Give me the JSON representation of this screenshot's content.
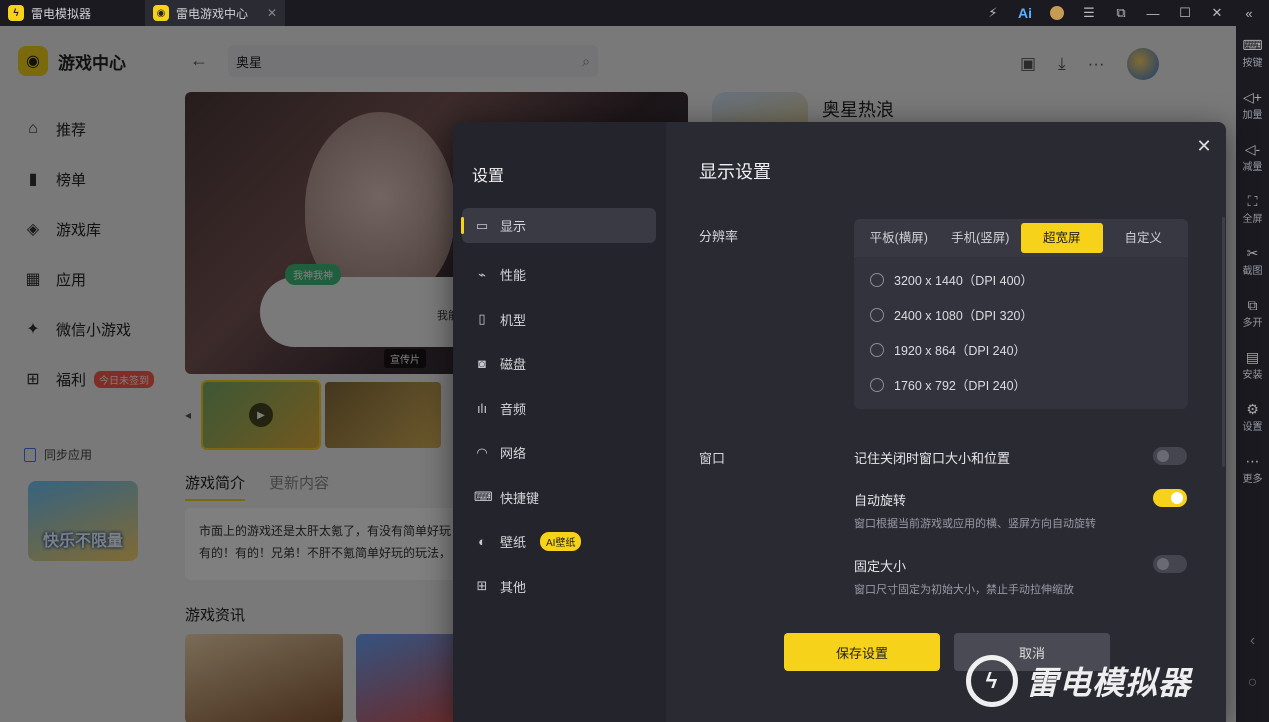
{
  "titlebar": {
    "tabs": [
      {
        "label": "雷电模拟器"
      },
      {
        "label": "雷电游戏中心"
      }
    ]
  },
  "right_toolbar": {
    "items": [
      {
        "label": "按键",
        "icon": "keyboard-icon"
      },
      {
        "label": "加量",
        "icon": "volume-up-icon"
      },
      {
        "label": "减量",
        "icon": "volume-down-icon"
      },
      {
        "label": "全屏",
        "icon": "fullscreen-icon"
      },
      {
        "label": "截图",
        "icon": "scissors-icon"
      },
      {
        "label": "多开",
        "icon": "multi-window-icon"
      },
      {
        "label": "安装",
        "icon": "install-icon"
      },
      {
        "label": "设置",
        "icon": "gear-icon"
      },
      {
        "label": "更多",
        "icon": "more-icon"
      }
    ]
  },
  "sidebar": {
    "brand": "游戏中心",
    "items": [
      {
        "label": "推荐",
        "icon": "home-icon"
      },
      {
        "label": "榜单",
        "icon": "chart-icon"
      },
      {
        "label": "游戏库",
        "icon": "gamepad-icon"
      },
      {
        "label": "应用",
        "icon": "apps-icon"
      },
      {
        "label": "微信小游戏",
        "icon": "mini-game-icon"
      },
      {
        "label": "福利",
        "icon": "gift-icon",
        "badge": "今日未签到"
      }
    ],
    "sync_label": "同步应用",
    "promo_text": "快乐不限量"
  },
  "header": {
    "search_value": "奥星"
  },
  "hero": {
    "tag": "我神我神",
    "bubble_text": "我能说",
    "video_tag": "宣传片"
  },
  "game": {
    "name": "奥星热浪"
  },
  "detail_tabs": {
    "intro": "游戏简介",
    "updates": "更新内容"
  },
  "intro_text": {
    "line1": "市面上的游戏还是太肝太氪了，有没有简单好玩",
    "line2": "有的！有的！兄弟！不肝不氪简单好玩的玩法，"
  },
  "news_title": "游戏资讯",
  "settings": {
    "title": "设置",
    "menu": [
      {
        "label": "显示",
        "icon": "monitor-icon"
      },
      {
        "label": "性能",
        "icon": "performance-icon"
      },
      {
        "label": "机型",
        "icon": "phone-icon"
      },
      {
        "label": "磁盘",
        "icon": "disk-icon"
      },
      {
        "label": "音频",
        "icon": "audio-icon"
      },
      {
        "label": "网络",
        "icon": "wifi-icon"
      },
      {
        "label": "快捷键",
        "icon": "keyboard-icon"
      },
      {
        "label": "壁纸",
        "icon": "palette-icon",
        "badge": "AI壁纸"
      },
      {
        "label": "其他",
        "icon": "grid-icon"
      }
    ],
    "display": {
      "heading": "显示设置",
      "resolution_label": "分辨率",
      "modes": [
        "平板(横屏)",
        "手机(竖屏)",
        "超宽屏",
        "自定义"
      ],
      "selected_mode": "超宽屏",
      "options": [
        "3200 x 1440（DPI 400）",
        "2400 x 1080（DPI 320）",
        "1920 x 864（DPI 240）",
        "1760 x 792（DPI 240）"
      ],
      "window_label": "窗口",
      "remember": {
        "label": "记住关闭时窗口大小和位置",
        "on": false
      },
      "auto_rotate": {
        "label": "自动旋转",
        "sub": "窗口根据当前游戏或应用的横、竖屏方向自动旋转",
        "on": true
      },
      "fixed_size": {
        "label": "固定大小",
        "sub": "窗口尺寸固定为初始大小，禁止手动拉伸缩放",
        "on": false
      }
    },
    "save_label": "保存设置",
    "cancel_label": "取消"
  },
  "watermark": "雷电模拟器",
  "colors": {
    "accent": "#f7d21b",
    "modal_bg": "#2a2a33",
    "modal_side": "#24242c"
  }
}
